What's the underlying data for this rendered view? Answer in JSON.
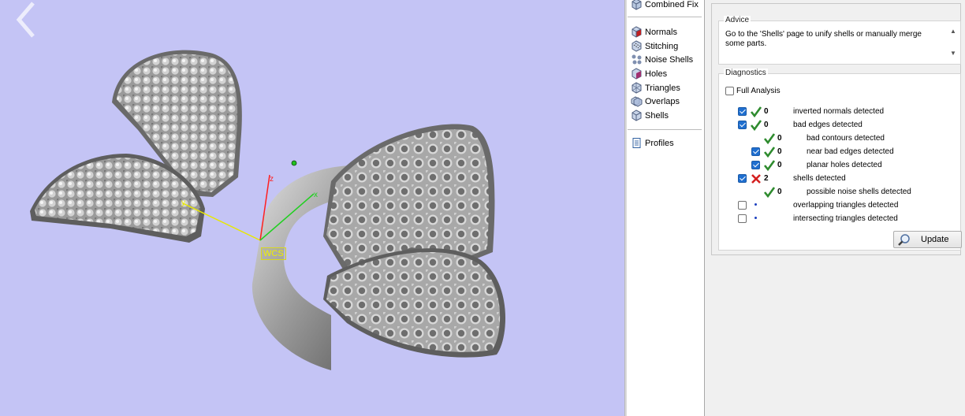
{
  "viewport": {
    "axis_label": "WCS",
    "axes": {
      "z": "z",
      "x": "x",
      "y": "y"
    }
  },
  "nav": {
    "combined_fix": "Combined Fix",
    "items": [
      {
        "label": "Normals",
        "icon": "normals-icon"
      },
      {
        "label": "Stitching",
        "icon": "stitching-icon"
      },
      {
        "label": "Noise Shells",
        "icon": "noise-shells-icon"
      },
      {
        "label": "Holes",
        "icon": "holes-icon"
      },
      {
        "label": "Triangles",
        "icon": "triangles-icon"
      },
      {
        "label": "Overlaps",
        "icon": "overlaps-icon"
      },
      {
        "label": "Shells",
        "icon": "shells-icon"
      }
    ],
    "profiles": "Profiles"
  },
  "advice": {
    "title": "Advice",
    "text": "Go to the 'Shells' page to unify shells or manually merge some parts."
  },
  "diagnostics": {
    "title": "Diagnostics",
    "full_analysis": "Full Analysis",
    "rows": [
      {
        "count": "0",
        "label": "inverted normals detected",
        "status": "ok",
        "checked": true
      },
      {
        "count": "0",
        "label": "bad edges detected",
        "status": "ok",
        "checked": true
      },
      {
        "count": "0",
        "label": "bad contours detected",
        "status": "ok",
        "checked": null
      },
      {
        "count": "0",
        "label": "near bad edges detected",
        "status": "ok",
        "checked": true
      },
      {
        "count": "0",
        "label": "planar holes detected",
        "status": "ok",
        "checked": true
      },
      {
        "count": "2",
        "label": "shells detected",
        "status": "error",
        "checked": true
      },
      {
        "count": "0",
        "label": "possible noise shells detected",
        "status": "ok",
        "checked": null
      },
      {
        "count": "",
        "label": "overlapping triangles detected",
        "status": "none",
        "checked": false
      },
      {
        "count": "",
        "label": "intersecting triangles detected",
        "status": "none",
        "checked": false
      }
    ]
  },
  "update_button": "Update",
  "colors": {
    "viewport_bg": "#c4c4f5",
    "ok": "#2e8b2e",
    "error": "#d42020",
    "checkbox": "#1f6fd0"
  }
}
